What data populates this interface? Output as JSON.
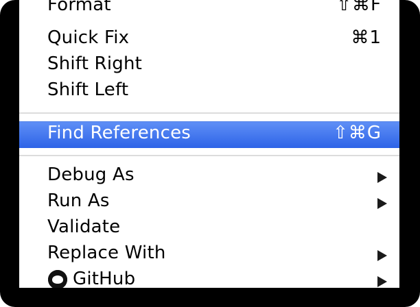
{
  "menu": {
    "items": [
      {
        "label": "Format",
        "shortcut": "⇧⌘F"
      },
      {
        "label": "Quick Fix",
        "shortcut": "⌘1"
      },
      {
        "label": "Shift Right",
        "shortcut": ""
      },
      {
        "label": "Shift Left",
        "shortcut": ""
      },
      {
        "label": "Find References",
        "shortcut": "⇧⌘G"
      },
      {
        "label": "Debug As",
        "shortcut": ""
      },
      {
        "label": "Run As",
        "shortcut": ""
      },
      {
        "label": "Validate",
        "shortcut": ""
      },
      {
        "label": "Replace With",
        "shortcut": ""
      },
      {
        "label": "GitHub",
        "shortcut": ""
      }
    ],
    "selected_index": 4
  },
  "colors": {
    "selection_top": "#5f8ff6",
    "selection_bottom": "#2d63e7",
    "separator": "#dcdcdc",
    "frame": "#000000"
  },
  "icons": {
    "submenu": "triangle-right-icon",
    "github": "github-octocat-icon"
  }
}
